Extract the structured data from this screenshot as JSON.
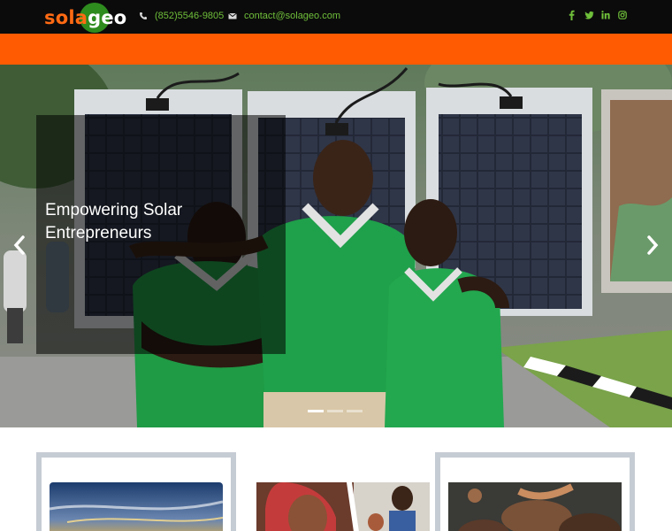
{
  "header": {
    "logo": {
      "part1": "sola",
      "part2": "geo"
    },
    "phone": "(852)5546-9805",
    "email": "contact@solageo.com",
    "social_icons": [
      "facebook-icon",
      "twitter-icon",
      "linkedin-icon",
      "instagram-icon"
    ]
  },
  "hero": {
    "caption": "Empowering Solar Entrepreneurs",
    "slides_total": 3,
    "active_slide": 1
  },
  "colors": {
    "topbar": "#0b0b0b",
    "accent_orange": "#ff5b03",
    "accent_green": "#6fbf3a",
    "card_border": "#c6ccd3"
  }
}
